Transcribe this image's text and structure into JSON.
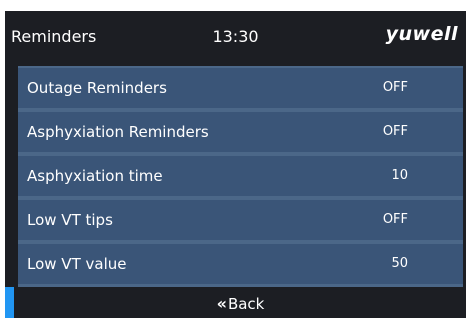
{
  "header": {
    "title": "Reminders",
    "time": "13:30",
    "brand": "yuwell"
  },
  "settings": {
    "items": [
      {
        "label": "Outage Reminders",
        "value": "OFF"
      },
      {
        "label": "Asphyxiation Reminders",
        "value": "OFF"
      },
      {
        "label": "Asphyxiation time",
        "value": "10"
      },
      {
        "label": "Low VT tips",
        "value": "OFF"
      },
      {
        "label": "Low VT value",
        "value": "50"
      }
    ]
  },
  "footer": {
    "back_icon": "double-chevron-left-icon",
    "back_label": "Back"
  },
  "colors": {
    "background": "#1c1e23",
    "row": "#3a5578",
    "divider": "#4b6788",
    "accent": "#2196f3",
    "text": "#ffffff"
  }
}
